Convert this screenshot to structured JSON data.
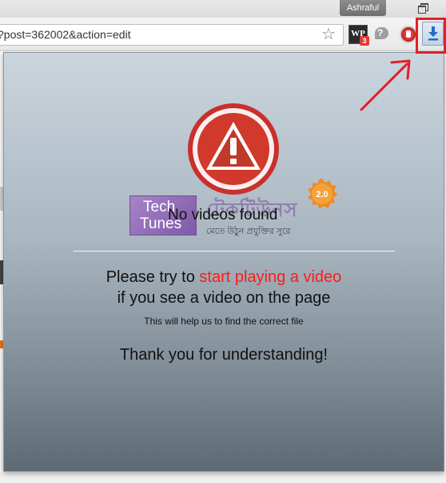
{
  "browser": {
    "user_name": "Ashraful",
    "url": "?post=362002&action=edit",
    "extensions": {
      "wp_label": "WP",
      "wp_badge": "3",
      "hangouts_glyph": "?"
    },
    "icons": {
      "bookmark": "star-icon",
      "download": "download-arrow-icon",
      "restore": "window-restore-icon"
    }
  },
  "popup": {
    "icon": "warning-icon",
    "status_text": "No videos found",
    "message_line1_prefix": "Please try to",
    "message_line1_highlight": "start playing a video",
    "message_line2": "if you see a video on the page",
    "help_text": "This will help us to find the correct file",
    "thanks_text": "Thank you for understanding!"
  },
  "watermark": {
    "line1": "Tech",
    "line2": "Tunes",
    "bangla_title": "টেকটিউনস",
    "bangla_tagline": "মেতে উঠুন প্রযুক্তির সুরে",
    "version": "2.0"
  },
  "colors": {
    "highlight": "#ff1a1a",
    "annotation": "#e0202a",
    "warning_red": "#d0392b"
  }
}
